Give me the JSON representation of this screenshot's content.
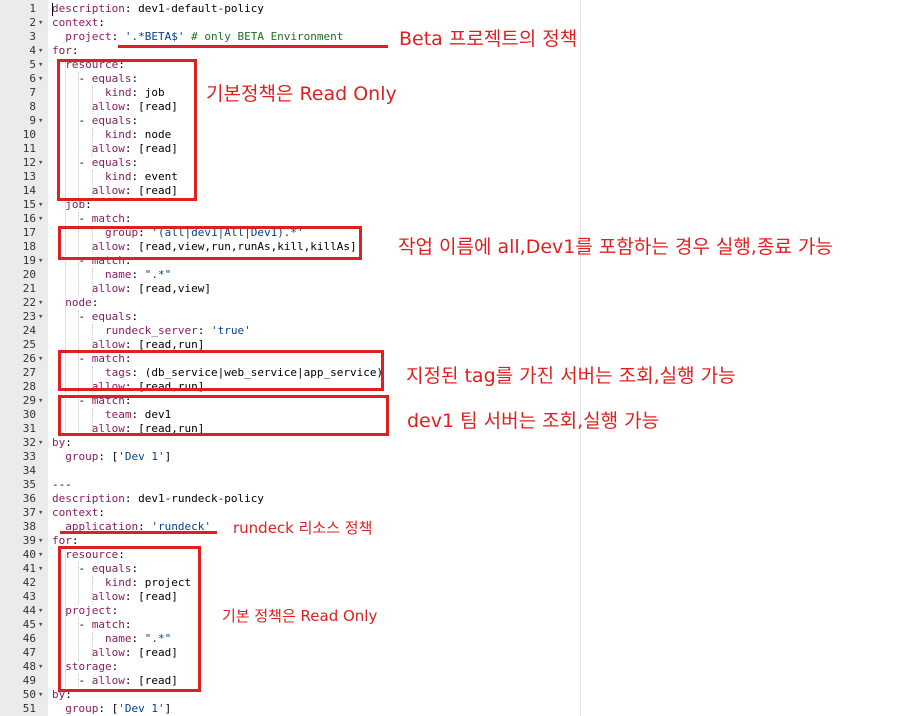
{
  "code_lines": [
    {
      "n": "1",
      "fold": "",
      "t": [
        {
          "c": "k",
          "v": "description"
        },
        {
          "c": "p",
          "v": ": dev1-default-policy"
        }
      ]
    },
    {
      "n": "2",
      "fold": "▾",
      "t": [
        {
          "c": "k",
          "v": "context"
        },
        {
          "c": "p",
          "v": ":"
        }
      ]
    },
    {
      "n": "3",
      "fold": "",
      "t": [
        {
          "c": "p",
          "v": "  "
        },
        {
          "c": "k",
          "v": "project"
        },
        {
          "c": "p",
          "v": ": "
        },
        {
          "c": "s",
          "v": "'.*BETA$'"
        },
        {
          "c": "p",
          "v": " "
        },
        {
          "c": "c",
          "v": "# only BETA Environment"
        }
      ]
    },
    {
      "n": "4",
      "fold": "▾",
      "t": [
        {
          "c": "k",
          "v": "for"
        },
        {
          "c": "p",
          "v": ":"
        }
      ]
    },
    {
      "n": "5",
      "fold": "▾",
      "t": [
        {
          "c": "p",
          "v": "  "
        },
        {
          "c": "k",
          "v": "resource"
        },
        {
          "c": "p",
          "v": ":"
        }
      ]
    },
    {
      "n": "6",
      "fold": "▾",
      "t": [
        {
          "c": "p",
          "v": "    - "
        },
        {
          "c": "k",
          "v": "equals"
        },
        {
          "c": "p",
          "v": ":"
        }
      ]
    },
    {
      "n": "7",
      "fold": "",
      "t": [
        {
          "c": "p",
          "v": "        "
        },
        {
          "c": "k",
          "v": "kind"
        },
        {
          "c": "p",
          "v": ": job"
        }
      ]
    },
    {
      "n": "8",
      "fold": "",
      "t": [
        {
          "c": "p",
          "v": "      "
        },
        {
          "c": "k",
          "v": "allow"
        },
        {
          "c": "p",
          "v": ": [read]"
        }
      ]
    },
    {
      "n": "9",
      "fold": "▾",
      "t": [
        {
          "c": "p",
          "v": "    - "
        },
        {
          "c": "k",
          "v": "equals"
        },
        {
          "c": "p",
          "v": ":"
        }
      ]
    },
    {
      "n": "10",
      "fold": "",
      "t": [
        {
          "c": "p",
          "v": "        "
        },
        {
          "c": "k",
          "v": "kind"
        },
        {
          "c": "p",
          "v": ": node"
        }
      ]
    },
    {
      "n": "11",
      "fold": "",
      "t": [
        {
          "c": "p",
          "v": "      "
        },
        {
          "c": "k",
          "v": "allow"
        },
        {
          "c": "p",
          "v": ": [read]"
        }
      ]
    },
    {
      "n": "12",
      "fold": "▾",
      "t": [
        {
          "c": "p",
          "v": "    - "
        },
        {
          "c": "k",
          "v": "equals"
        },
        {
          "c": "p",
          "v": ":"
        }
      ]
    },
    {
      "n": "13",
      "fold": "",
      "t": [
        {
          "c": "p",
          "v": "        "
        },
        {
          "c": "k",
          "v": "kind"
        },
        {
          "c": "p",
          "v": ": event"
        }
      ]
    },
    {
      "n": "14",
      "fold": "",
      "t": [
        {
          "c": "p",
          "v": "      "
        },
        {
          "c": "k",
          "v": "allow"
        },
        {
          "c": "p",
          "v": ": [read]"
        }
      ]
    },
    {
      "n": "15",
      "fold": "▾",
      "t": [
        {
          "c": "p",
          "v": "  "
        },
        {
          "c": "k",
          "v": "job"
        },
        {
          "c": "p",
          "v": ":"
        }
      ]
    },
    {
      "n": "16",
      "fold": "▾",
      "t": [
        {
          "c": "p",
          "v": "    - "
        },
        {
          "c": "k",
          "v": "match"
        },
        {
          "c": "p",
          "v": ":"
        }
      ]
    },
    {
      "n": "17",
      "fold": "",
      "t": [
        {
          "c": "p",
          "v": "        "
        },
        {
          "c": "k",
          "v": "group"
        },
        {
          "c": "p",
          "v": ": "
        },
        {
          "c": "s",
          "v": "'(all|dev1|All|Dev1).*'"
        }
      ]
    },
    {
      "n": "18",
      "fold": "",
      "t": [
        {
          "c": "p",
          "v": "      "
        },
        {
          "c": "k",
          "v": "allow"
        },
        {
          "c": "p",
          "v": ": [read,view,run,runAs,kill,killAs]"
        }
      ]
    },
    {
      "n": "19",
      "fold": "▾",
      "t": [
        {
          "c": "p",
          "v": "    - "
        },
        {
          "c": "k",
          "v": "match"
        },
        {
          "c": "p",
          "v": ":"
        }
      ]
    },
    {
      "n": "20",
      "fold": "",
      "t": [
        {
          "c": "p",
          "v": "        "
        },
        {
          "c": "k",
          "v": "name"
        },
        {
          "c": "p",
          "v": ": "
        },
        {
          "c": "s",
          "v": "\".*\""
        }
      ]
    },
    {
      "n": "21",
      "fold": "",
      "t": [
        {
          "c": "p",
          "v": "      "
        },
        {
          "c": "k",
          "v": "allow"
        },
        {
          "c": "p",
          "v": ": [read,view]"
        }
      ]
    },
    {
      "n": "22",
      "fold": "▾",
      "t": [
        {
          "c": "p",
          "v": "  "
        },
        {
          "c": "k",
          "v": "node"
        },
        {
          "c": "p",
          "v": ":"
        }
      ]
    },
    {
      "n": "23",
      "fold": "▾",
      "t": [
        {
          "c": "p",
          "v": "    - "
        },
        {
          "c": "k",
          "v": "equals"
        },
        {
          "c": "p",
          "v": ":"
        }
      ]
    },
    {
      "n": "24",
      "fold": "",
      "t": [
        {
          "c": "p",
          "v": "        "
        },
        {
          "c": "k",
          "v": "rundeck_server"
        },
        {
          "c": "p",
          "v": ": "
        },
        {
          "c": "s",
          "v": "'true'"
        }
      ]
    },
    {
      "n": "25",
      "fold": "",
      "t": [
        {
          "c": "p",
          "v": "      "
        },
        {
          "c": "k",
          "v": "allow"
        },
        {
          "c": "p",
          "v": ": [read,run]"
        }
      ]
    },
    {
      "n": "26",
      "fold": "▾",
      "t": [
        {
          "c": "p",
          "v": "    - "
        },
        {
          "c": "k",
          "v": "match"
        },
        {
          "c": "p",
          "v": ":"
        }
      ]
    },
    {
      "n": "27",
      "fold": "",
      "t": [
        {
          "c": "p",
          "v": "        "
        },
        {
          "c": "k",
          "v": "tags"
        },
        {
          "c": "p",
          "v": ": (db_service|web_service|app_service)"
        }
      ]
    },
    {
      "n": "28",
      "fold": "",
      "t": [
        {
          "c": "p",
          "v": "      "
        },
        {
          "c": "k",
          "v": "allow"
        },
        {
          "c": "p",
          "v": ": [read,run]"
        }
      ]
    },
    {
      "n": "29",
      "fold": "▾",
      "t": [
        {
          "c": "p",
          "v": "    - "
        },
        {
          "c": "k",
          "v": "match"
        },
        {
          "c": "p",
          "v": ":"
        }
      ]
    },
    {
      "n": "30",
      "fold": "",
      "t": [
        {
          "c": "p",
          "v": "        "
        },
        {
          "c": "k",
          "v": "team"
        },
        {
          "c": "p",
          "v": ": dev1"
        }
      ]
    },
    {
      "n": "31",
      "fold": "",
      "t": [
        {
          "c": "p",
          "v": "      "
        },
        {
          "c": "k",
          "v": "allow"
        },
        {
          "c": "p",
          "v": ": [read,run]"
        }
      ]
    },
    {
      "n": "32",
      "fold": "▾",
      "t": [
        {
          "c": "k",
          "v": "by"
        },
        {
          "c": "p",
          "v": ":"
        }
      ]
    },
    {
      "n": "33",
      "fold": "",
      "t": [
        {
          "c": "p",
          "v": "  "
        },
        {
          "c": "k",
          "v": "group"
        },
        {
          "c": "p",
          "v": ": ["
        },
        {
          "c": "s",
          "v": "'Dev 1'"
        },
        {
          "c": "p",
          "v": "]"
        }
      ]
    },
    {
      "n": "34",
      "fold": "",
      "t": []
    },
    {
      "n": "35",
      "fold": "",
      "t": [
        {
          "c": "p",
          "v": "---"
        }
      ]
    },
    {
      "n": "36",
      "fold": "",
      "t": [
        {
          "c": "k",
          "v": "description"
        },
        {
          "c": "p",
          "v": ": dev1-rundeck-policy"
        }
      ]
    },
    {
      "n": "37",
      "fold": "▾",
      "t": [
        {
          "c": "k",
          "v": "context"
        },
        {
          "c": "p",
          "v": ":"
        }
      ]
    },
    {
      "n": "38",
      "fold": "",
      "t": [
        {
          "c": "p",
          "v": "  "
        },
        {
          "c": "k",
          "v": "application"
        },
        {
          "c": "p",
          "v": ": "
        },
        {
          "c": "s",
          "v": "'rundeck'"
        }
      ]
    },
    {
      "n": "39",
      "fold": "▾",
      "t": [
        {
          "c": "k",
          "v": "for"
        },
        {
          "c": "p",
          "v": ":"
        }
      ]
    },
    {
      "n": "40",
      "fold": "▾",
      "t": [
        {
          "c": "p",
          "v": "  "
        },
        {
          "c": "k",
          "v": "resource"
        },
        {
          "c": "p",
          "v": ":"
        }
      ]
    },
    {
      "n": "41",
      "fold": "▾",
      "t": [
        {
          "c": "p",
          "v": "    - "
        },
        {
          "c": "k",
          "v": "equals"
        },
        {
          "c": "p",
          "v": ":"
        }
      ]
    },
    {
      "n": "42",
      "fold": "",
      "t": [
        {
          "c": "p",
          "v": "        "
        },
        {
          "c": "k",
          "v": "kind"
        },
        {
          "c": "p",
          "v": ": project"
        }
      ]
    },
    {
      "n": "43",
      "fold": "",
      "t": [
        {
          "c": "p",
          "v": "      "
        },
        {
          "c": "k",
          "v": "allow"
        },
        {
          "c": "p",
          "v": ": [read]"
        }
      ]
    },
    {
      "n": "44",
      "fold": "▾",
      "t": [
        {
          "c": "p",
          "v": "  "
        },
        {
          "c": "k",
          "v": "project"
        },
        {
          "c": "p",
          "v": ":"
        }
      ]
    },
    {
      "n": "45",
      "fold": "▾",
      "t": [
        {
          "c": "p",
          "v": "    - "
        },
        {
          "c": "k",
          "v": "match"
        },
        {
          "c": "p",
          "v": ":"
        }
      ]
    },
    {
      "n": "46",
      "fold": "",
      "t": [
        {
          "c": "p",
          "v": "        "
        },
        {
          "c": "k",
          "v": "name"
        },
        {
          "c": "p",
          "v": ": "
        },
        {
          "c": "s",
          "v": "\".*\""
        }
      ]
    },
    {
      "n": "47",
      "fold": "",
      "t": [
        {
          "c": "p",
          "v": "      "
        },
        {
          "c": "k",
          "v": "allow"
        },
        {
          "c": "p",
          "v": ": [read]"
        }
      ]
    },
    {
      "n": "48",
      "fold": "▾",
      "t": [
        {
          "c": "p",
          "v": "  "
        },
        {
          "c": "k",
          "v": "storage"
        },
        {
          "c": "p",
          "v": ":"
        }
      ]
    },
    {
      "n": "49",
      "fold": "",
      "t": [
        {
          "c": "p",
          "v": "    - "
        },
        {
          "c": "k",
          "v": "allow"
        },
        {
          "c": "p",
          "v": ": [read]"
        }
      ]
    },
    {
      "n": "50",
      "fold": "▾",
      "t": [
        {
          "c": "k",
          "v": "by"
        },
        {
          "c": "p",
          "v": ":"
        }
      ]
    },
    {
      "n": "51",
      "fold": "",
      "t": [
        {
          "c": "p",
          "v": "  "
        },
        {
          "c": "k",
          "v": "group"
        },
        {
          "c": "p",
          "v": ": ["
        },
        {
          "c": "s",
          "v": "'Dev 1'"
        },
        {
          "c": "p",
          "v": "]"
        }
      ]
    }
  ],
  "annotations": {
    "beta_project_policy": "Beta 프로젝트의 정책",
    "default_read_only": "기본정책은 Read Only",
    "job_name_policy": "작업 이름에 all,Dev1를 포함하는 경우 실행,종료 가능",
    "tag_server_policy": "지정된 tag를 가진 서버는 조회,실행 가능",
    "team_server_policy": "dev1 팀 서버는 조회,실행 가능",
    "rundeck_resource_policy": "rundeck 리소스 정책",
    "default_read_only_2": "기본 정책은 Read Only"
  },
  "colors": {
    "annotation": "#e02020",
    "key": "#8a1c62",
    "string": "#0a3f86",
    "comment": "#236e24",
    "gutter": "#ebebeb"
  }
}
